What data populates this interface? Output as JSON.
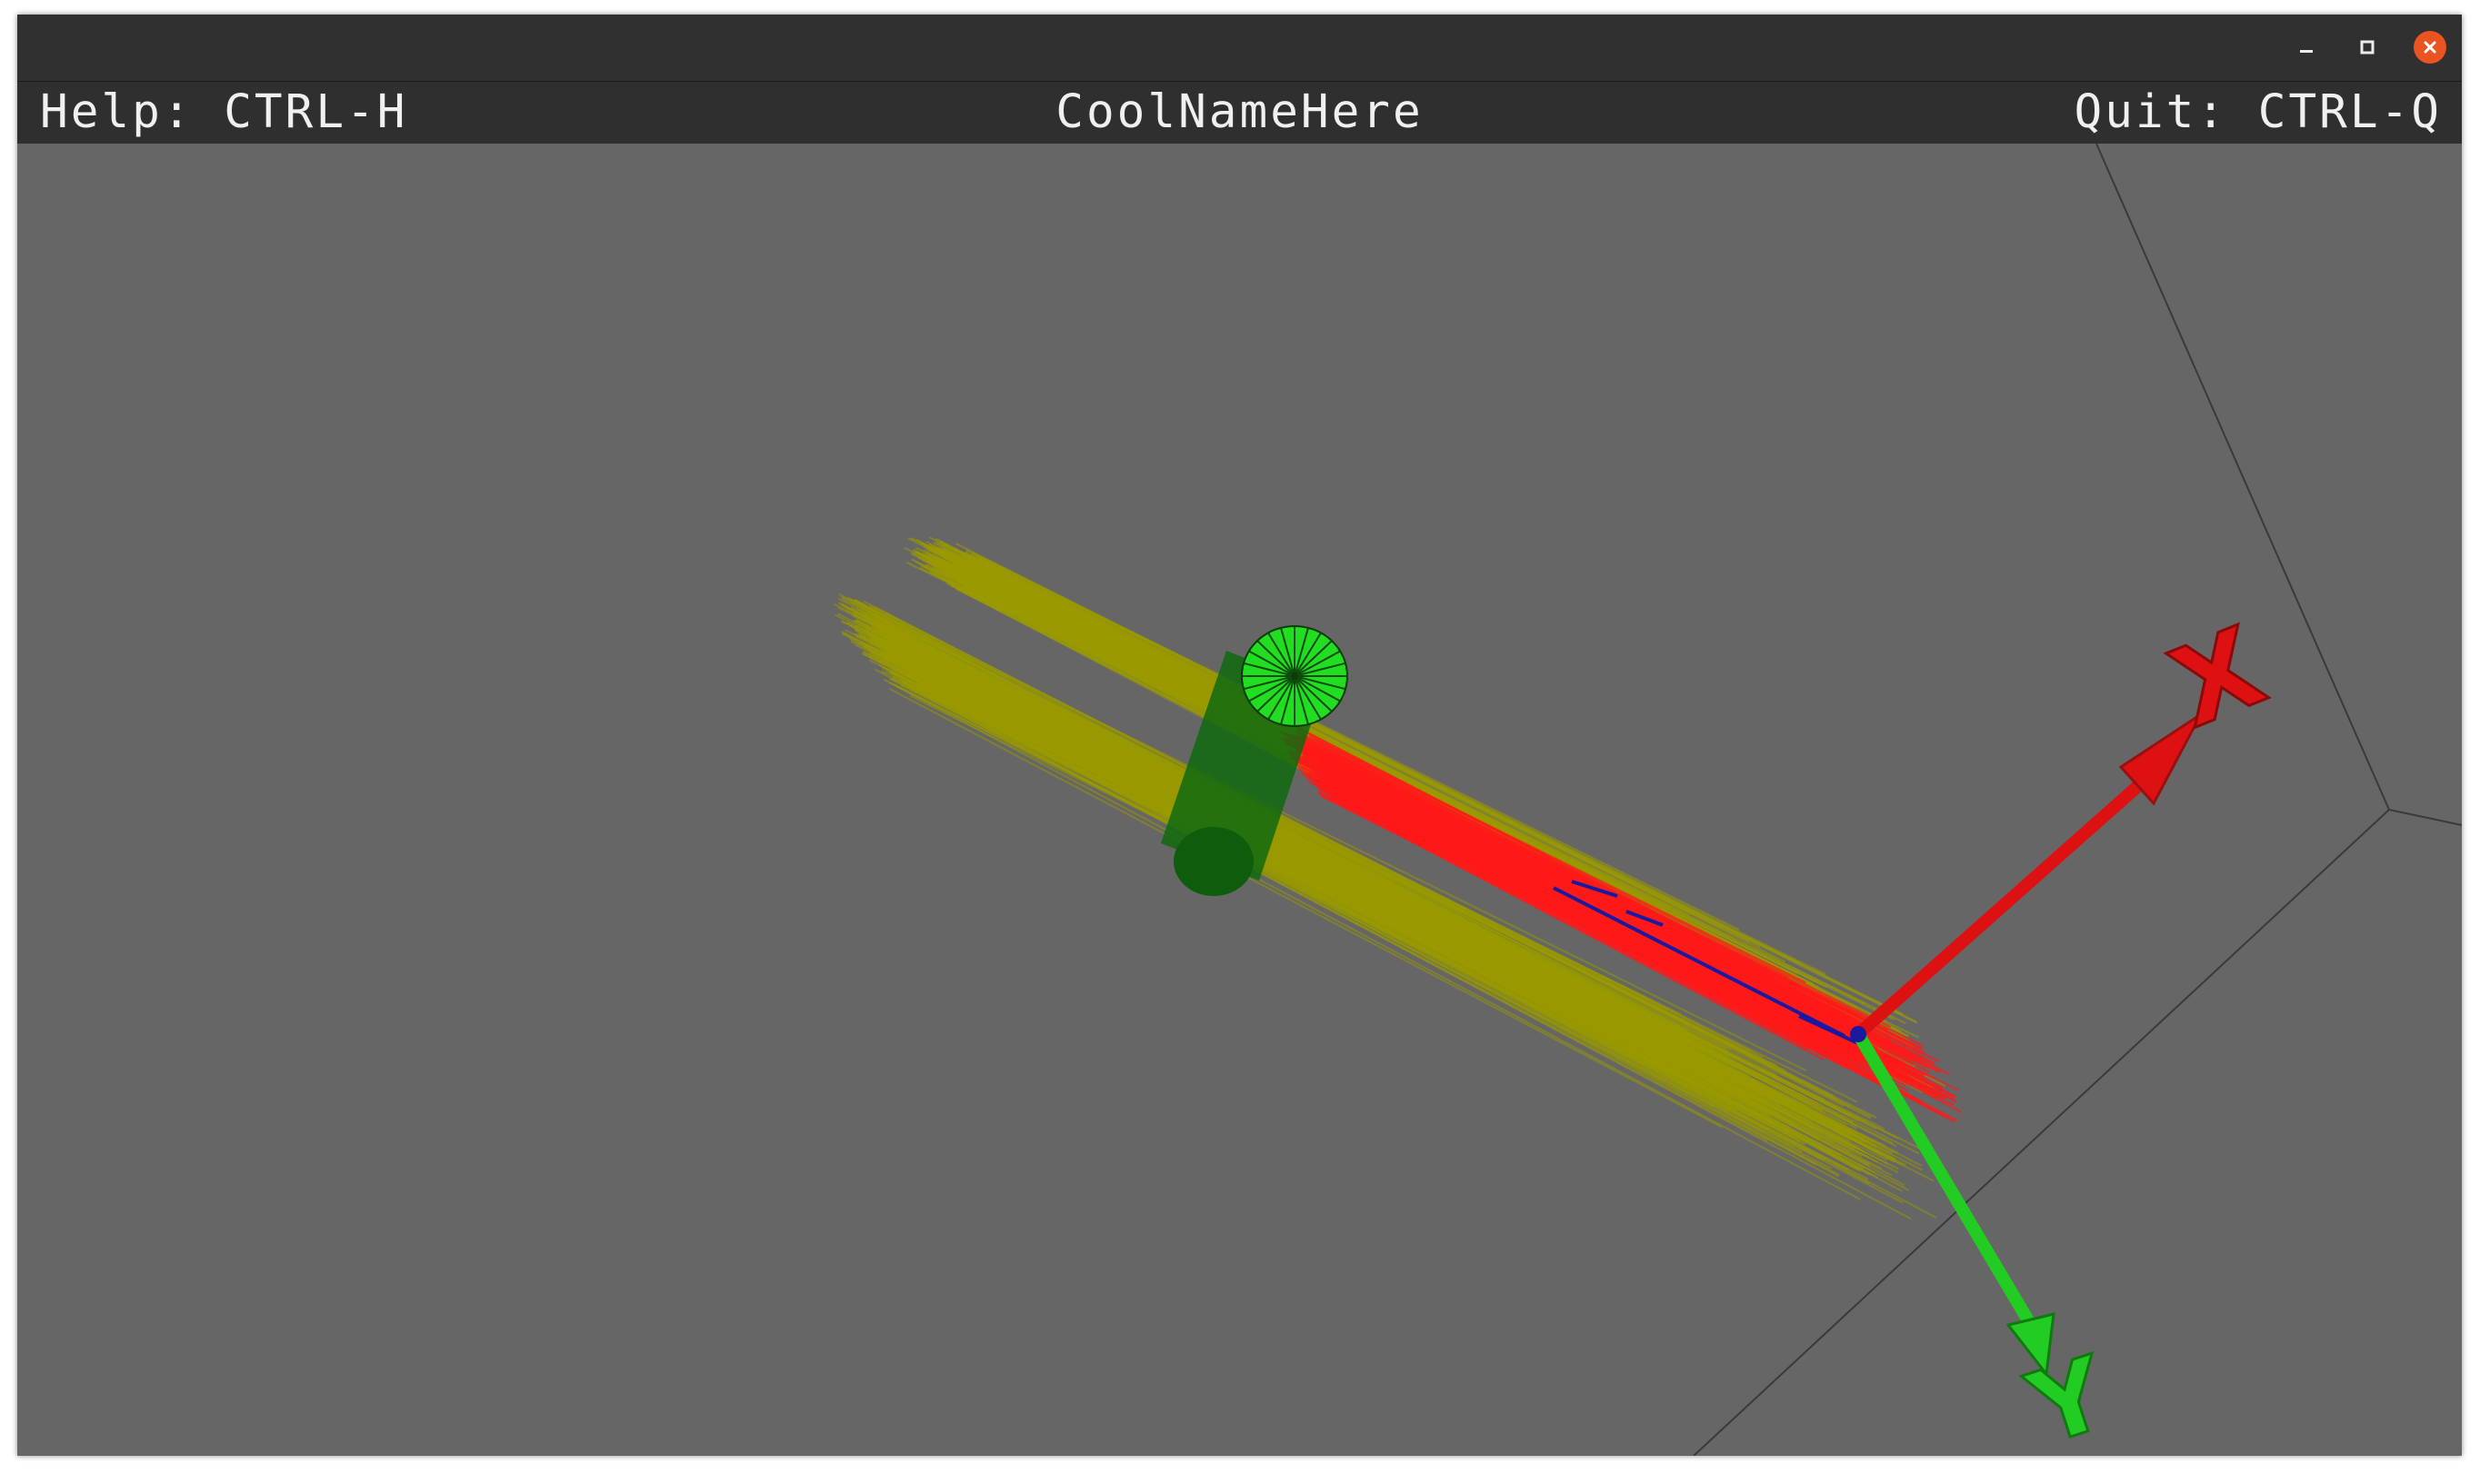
{
  "window": {
    "controls": {
      "minimize_icon": "minimize-icon",
      "maximize_icon": "maximize-icon",
      "close_icon": "close-icon"
    }
  },
  "overlay": {
    "help_text": "Help: CTRL-H",
    "title_text": "CoolNameHere",
    "quit_text": "Quit: CTRL-Q"
  },
  "scene": {
    "background_color": "#666666",
    "grid_line_color": "#3a3a3a",
    "trajectory_colors": {
      "yellow": "#9a9a00",
      "red": "#ff0000",
      "blue": "#1a1aa0"
    },
    "cylinder_color": "#22dd22",
    "axes": {
      "x": {
        "label": "X",
        "color": "#dd1111"
      },
      "y": {
        "label": "Y",
        "color": "#22cc22"
      }
    }
  }
}
